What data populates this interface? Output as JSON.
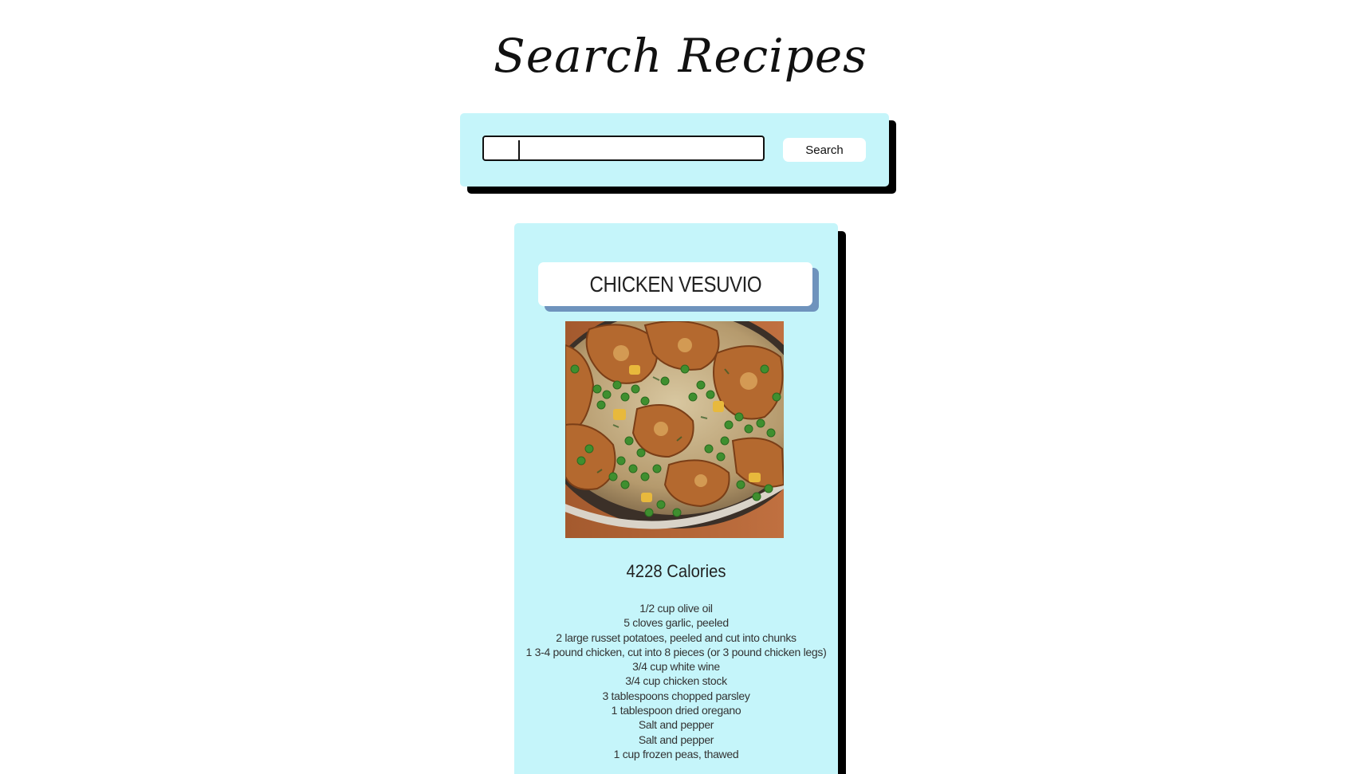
{
  "header": {
    "title": "Search Recipes"
  },
  "search": {
    "value": "",
    "button_label": "Search"
  },
  "recipe": {
    "title": "CHICKEN VESUVIO",
    "image_alt": "chicken-vesuvio-photo",
    "calories": "4228 Calories",
    "ingredients": [
      "1/2 cup olive oil",
      "5 cloves garlic, peeled",
      "2 large russet potatoes, peeled and cut into chunks",
      "1 3-4 pound chicken, cut into 8 pieces (or 3 pound chicken legs)",
      "3/4 cup white wine",
      "3/4 cup chicken stock",
      "3 tablespoons chopped parsley",
      "1 tablespoon dried oregano",
      "Salt and pepper",
      "Salt and pepper",
      "1 cup frozen peas, thawed"
    ]
  },
  "colors": {
    "panel": "#c5f5fa",
    "shadow": "#000000",
    "title_shadow": "#6f93bd"
  }
}
